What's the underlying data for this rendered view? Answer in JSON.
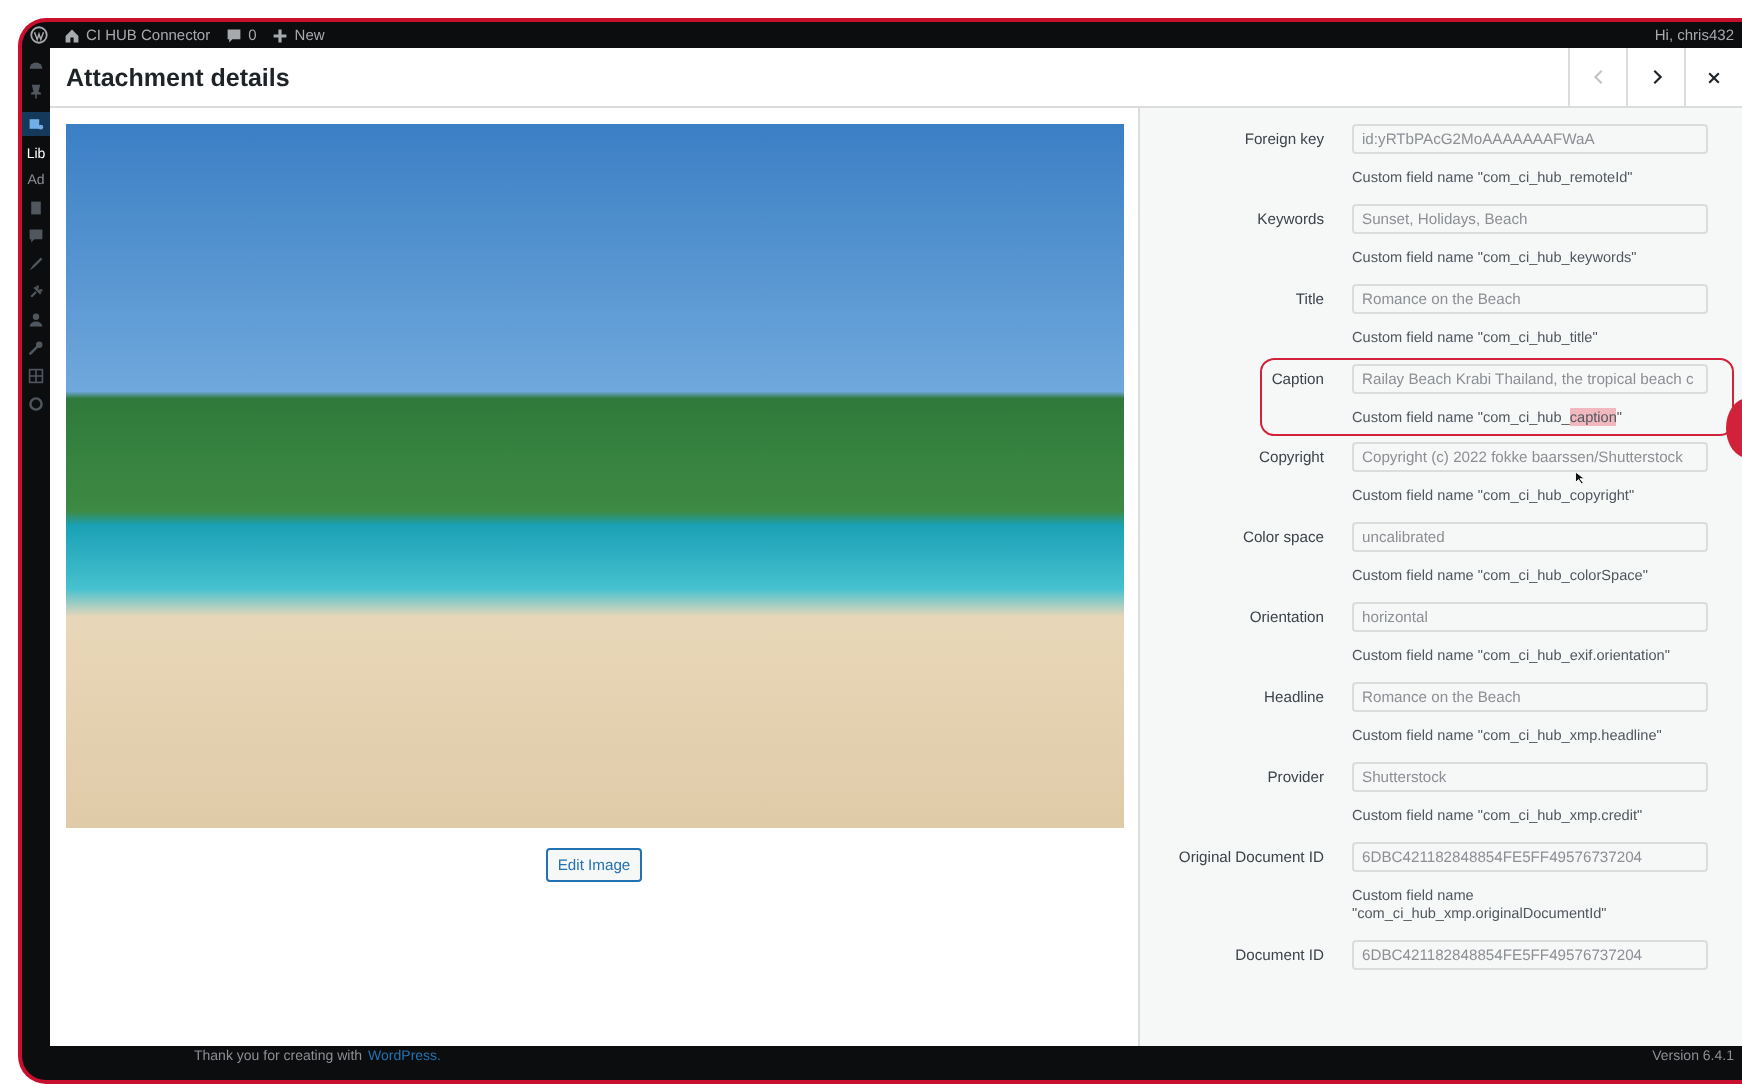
{
  "admin_bar": {
    "site": "CI HUB Connector",
    "comments": "0",
    "new": "New",
    "greeting": "Hi, chris432"
  },
  "sidebar": {
    "menu_title": "Lib",
    "submenu_item": "Ad"
  },
  "modal": {
    "title": "Attachment details",
    "previous": {
      "disabled": true
    },
    "next": {
      "disabled": false
    },
    "edit_button": "Edit Image",
    "fields": [
      {
        "label": "Foreign key",
        "value": "id:yRTbPAcG2MoAAAAAAAFWaA",
        "hint": "Custom field name \"com_ci_hub_remoteId\"",
        "highlighted": false
      },
      {
        "label": "Keywords",
        "value": "Sunset, Holidays, Beach",
        "hint": "Custom field name \"com_ci_hub_keywords\"",
        "highlighted": false
      },
      {
        "label": "Title",
        "value": "Romance on the Beach",
        "hint": "Custom field name \"com_ci_hub_title\"",
        "highlighted": false
      },
      {
        "label": "Caption",
        "value": "Railay Beach Krabi Thailand, the tropical beach c",
        "hint": "Custom field name \"com_ci_hub_",
        "selected_text": "caption",
        "hint_after": "\"",
        "highlighted": true
      },
      {
        "label": "Copyright",
        "value": "Copyright (c) 2022 fokke baarssen/Shutterstock",
        "hint": "Custom field name \"com_ci_hub_copyright\"",
        "highlighted": false
      },
      {
        "label": "Color space",
        "value": "uncalibrated",
        "hint": "Custom field name \"com_ci_hub_colorSpace\"",
        "highlighted": false
      },
      {
        "label": "Orientation",
        "value": "horizontal",
        "hint": "Custom field name \"com_ci_hub_exif.orientation\"",
        "highlighted": false
      },
      {
        "label": "Headline",
        "value": "Romance on the Beach",
        "hint": "Custom field name \"com_ci_hub_xmp.headline\"",
        "highlighted": false
      },
      {
        "label": "Provider",
        "value": "Shutterstock",
        "hint": "Custom field name \"com_ci_hub_xmp.credit\"",
        "highlighted": false
      },
      {
        "label": "Original Document ID",
        "value": "6DBC421182848854FE5FF49576737204",
        "hint": "Custom field name \"com_ci_hub_xmp.originalDocumentId\"",
        "highlighted": false
      },
      {
        "label": "Document ID",
        "value": "6DBC421182848854FE5FF49576737204",
        "highlighted": false
      }
    ]
  },
  "footer": {
    "thanks": "Thank you for creating with",
    "link": "WordPress.",
    "version": "Version 6.4.1"
  }
}
